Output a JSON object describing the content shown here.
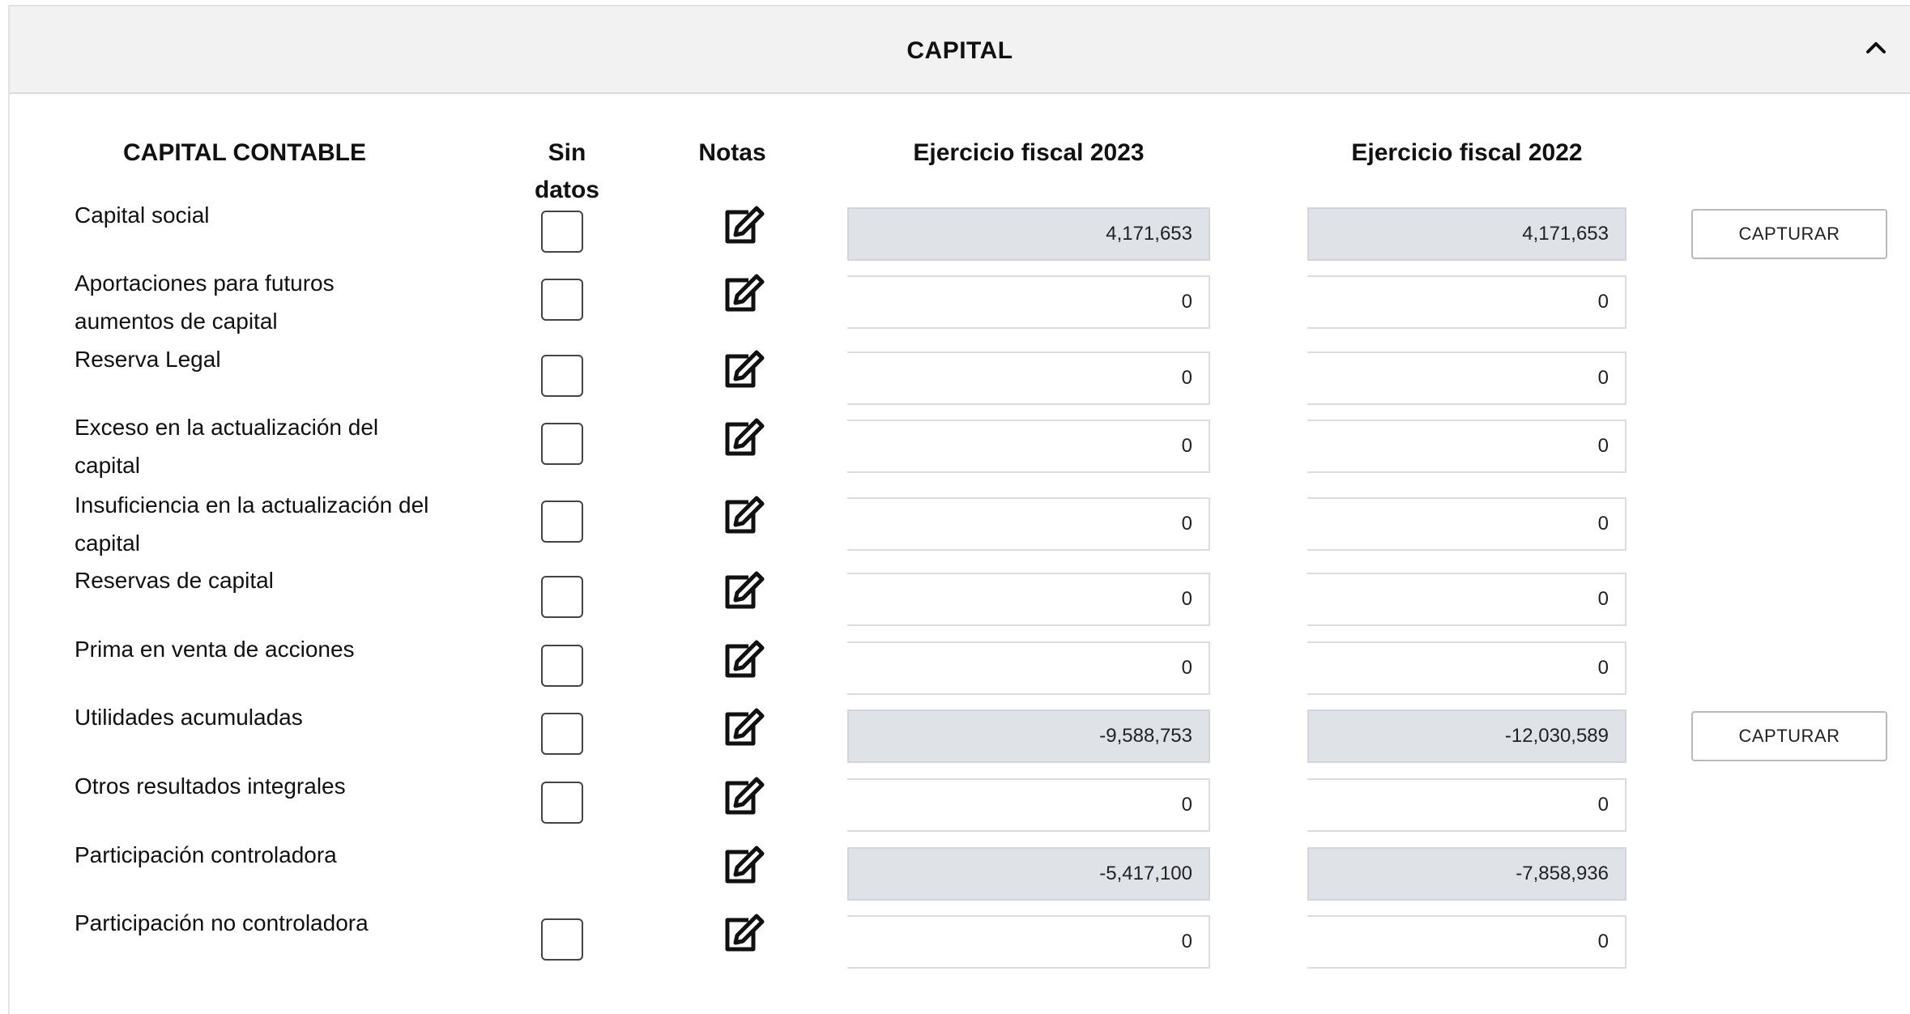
{
  "panel": {
    "title": "CAPITAL"
  },
  "columns": {
    "concept": "CAPITAL CONTABLE",
    "no_data": "Sin datos",
    "notes": "Notas",
    "year_current": "Ejercicio fiscal 2023",
    "year_previous": "Ejercicio fiscal 2022"
  },
  "rows": [
    {
      "label": "Capital social",
      "has_checkbox": true,
      "y2023": "4,171,653",
      "y2022": "4,171,653",
      "computed": true,
      "capture": "CAPTURAR"
    },
    {
      "label": "Aportaciones para futuros aumentos de capital",
      "has_checkbox": true,
      "y2023": "0",
      "y2022": "0",
      "computed": false,
      "capture": ""
    },
    {
      "label": "Reserva Legal",
      "has_checkbox": true,
      "y2023": "0",
      "y2022": "0",
      "computed": false,
      "capture": ""
    },
    {
      "label": "Exceso en la actualización del capital",
      "has_checkbox": true,
      "y2023": "0",
      "y2022": "0",
      "computed": false,
      "capture": ""
    },
    {
      "label": "Insuficiencia en la actualización del capital",
      "has_checkbox": true,
      "y2023": "0",
      "y2022": "0",
      "computed": false,
      "capture": ""
    },
    {
      "label": "Reservas de capital",
      "has_checkbox": true,
      "y2023": "0",
      "y2022": "0",
      "computed": false,
      "capture": ""
    },
    {
      "label": "Prima en venta de acciones",
      "has_checkbox": true,
      "y2023": "0",
      "y2022": "0",
      "computed": false,
      "capture": ""
    },
    {
      "label": "Utilidades acumuladas",
      "has_checkbox": true,
      "y2023": "-9,588,753",
      "y2022": "-12,030,589",
      "computed": true,
      "capture": "CAPTURAR"
    },
    {
      "label": "Otros resultados integrales",
      "has_checkbox": true,
      "y2023": "0",
      "y2022": "0",
      "computed": false,
      "capture": ""
    },
    {
      "label": "Participación controladora",
      "has_checkbox": false,
      "y2023": "-5,417,100",
      "y2022": "-7,858,936",
      "computed": true,
      "capture": ""
    },
    {
      "label": "Participación no controladora",
      "has_checkbox": true,
      "y2023": "0",
      "y2022": "0",
      "computed": false,
      "capture": ""
    }
  ],
  "icons": {
    "collapse": "chevron-up-icon",
    "note": "edit-note-icon"
  },
  "colors": {
    "header_bg": "#f2f2f2",
    "computed_field_bg": "#dfe3e8",
    "border": "#dcdcdc"
  }
}
